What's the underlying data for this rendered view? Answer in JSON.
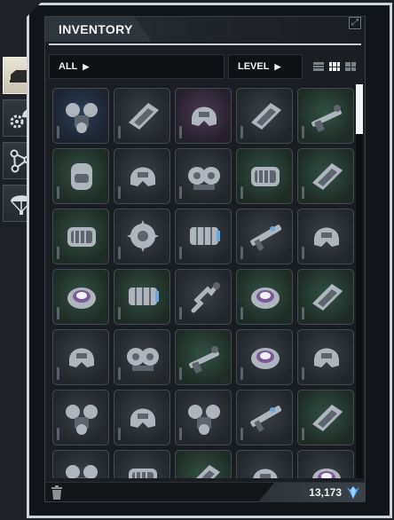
{
  "title": "INVENTORY",
  "filters": {
    "category": "ALL",
    "sort": "LEVEL"
  },
  "view_modes": [
    "list-view-icon",
    "grid-small-view-icon",
    "grid-large-view-icon"
  ],
  "active_view_mode": "grid-small-view-icon",
  "categories": [
    {
      "name": "vehicle-category",
      "active": true
    },
    {
      "name": "cog-leaf-category",
      "active": false
    },
    {
      "name": "node-graph-category",
      "active": false
    },
    {
      "name": "parachute-category",
      "active": false
    }
  ],
  "items": [
    {
      "icon": "jetpack-icon",
      "tint": "blue"
    },
    {
      "icon": "chip-icon",
      "tint": "gray"
    },
    {
      "icon": "helmet-icon",
      "tint": "purple"
    },
    {
      "icon": "chip-icon",
      "tint": "gray"
    },
    {
      "icon": "shotgun-icon",
      "tint": "green"
    },
    {
      "icon": "backpack-icon",
      "tint": "green"
    },
    {
      "icon": "helmet-icon",
      "tint": "gray"
    },
    {
      "icon": "engine-icon",
      "tint": "gray"
    },
    {
      "icon": "canister-icon",
      "tint": "green"
    },
    {
      "icon": "chip-icon",
      "tint": "green"
    },
    {
      "icon": "canister-icon",
      "tint": "green"
    },
    {
      "icon": "gyro-icon",
      "tint": "gray"
    },
    {
      "icon": "battery-icon",
      "tint": "gray"
    },
    {
      "icon": "rifle-icon",
      "tint": "gray"
    },
    {
      "icon": "helmet-icon",
      "tint": "gray"
    },
    {
      "icon": "disc-icon",
      "tint": "green"
    },
    {
      "icon": "battery-icon",
      "tint": "green"
    },
    {
      "icon": "grapple-icon",
      "tint": "gray"
    },
    {
      "icon": "disc-icon",
      "tint": "green"
    },
    {
      "icon": "chip-icon",
      "tint": "green"
    },
    {
      "icon": "helmet-icon",
      "tint": "gray"
    },
    {
      "icon": "engine-icon",
      "tint": "gray"
    },
    {
      "icon": "shotgun-icon",
      "tint": "green"
    },
    {
      "icon": "disc-icon",
      "tint": "gray"
    },
    {
      "icon": "helmet-icon",
      "tint": "gray"
    },
    {
      "icon": "jetpack-icon",
      "tint": "gray"
    },
    {
      "icon": "helmet-icon",
      "tint": "gray"
    },
    {
      "icon": "jetpack-icon",
      "tint": "gray"
    },
    {
      "icon": "rifle-icon",
      "tint": "gray"
    },
    {
      "icon": "chip-icon",
      "tint": "green"
    },
    {
      "icon": "jetpack-icon",
      "tint": "gray"
    },
    {
      "icon": "canister-icon",
      "tint": "gray"
    },
    {
      "icon": "chip-icon",
      "tint": "green"
    },
    {
      "icon": "helmet-icon",
      "tint": "gray"
    },
    {
      "icon": "disc-icon",
      "tint": "gray"
    }
  ],
  "currency": {
    "amount": "13,173",
    "icon": "crystal-currency-icon"
  },
  "colors": {
    "frame": "#cfd4da",
    "panel": "#1a1d22",
    "active_tab": "#e9e4d6",
    "gem": "#4aa8ff"
  }
}
